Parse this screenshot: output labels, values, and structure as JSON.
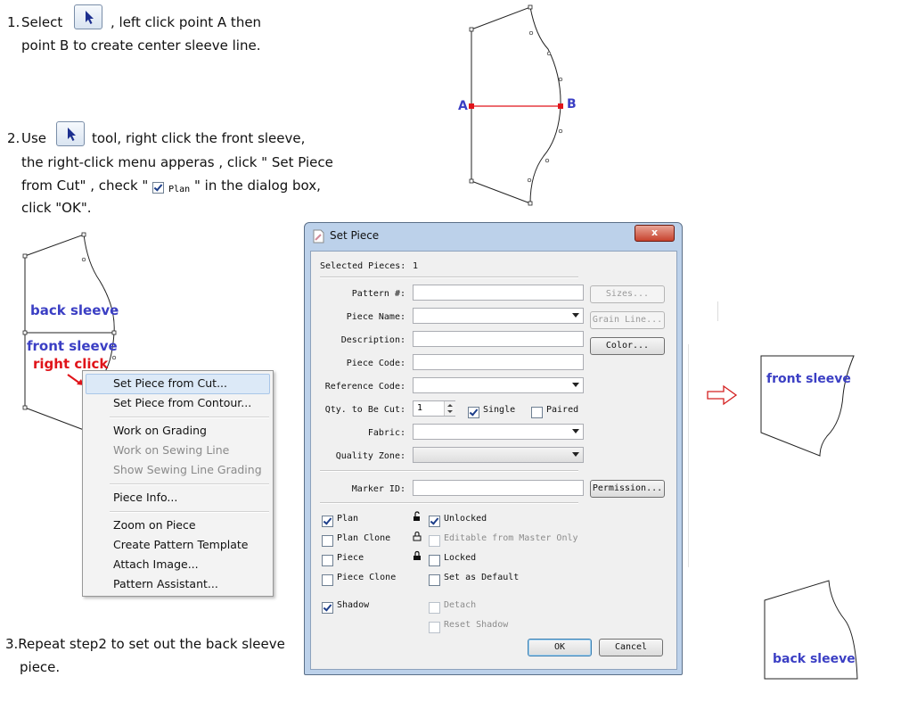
{
  "steps": {
    "s1_num": "1.",
    "s1_a": "Select",
    "s1_b": ", left click point A then",
    "s1_c": "point B to create center sleeve line.",
    "s2_num": "2.",
    "s2_a": "Use",
    "s2_b": "tool, right click the front sleeve,",
    "s2_c": "the right-click menu apperas , click \" Set Piece",
    "s2_d": "from Cut\" , check \"",
    "s2_plan": "Plan",
    "s2_e": "\"    in the dialog box,",
    "s2_f": "click \"OK\".",
    "s3_a": "3.Repeat step2 to set out the back sleeve",
    "s3_b": "piece."
  },
  "diagram": {
    "point_a": "A",
    "point_b": "B"
  },
  "labels": {
    "back_sleeve": "back sleeve",
    "front_sleeve": "front sleeve",
    "right_click": "right click",
    "front_sleeve_piece": "front sleeve",
    "back_sleeve_piece": "back sleeve"
  },
  "context_menu": {
    "items": [
      {
        "label": "Set Piece from Cut...",
        "state": "highlighted"
      },
      {
        "label": "Set Piece from Contour...",
        "state": "normal"
      },
      {
        "label": "Work on Grading",
        "state": "normal"
      },
      {
        "label": "Work on Sewing Line",
        "state": "disabled"
      },
      {
        "label": "Show Sewing Line Grading",
        "state": "disabled"
      },
      {
        "label": "Piece Info...",
        "state": "normal"
      },
      {
        "label": "Zoom on Piece",
        "state": "normal"
      },
      {
        "label": "Create Pattern Template",
        "state": "normal"
      },
      {
        "label": "Attach Image...",
        "state": "normal"
      },
      {
        "label": "Pattern Assistant...",
        "state": "normal"
      }
    ]
  },
  "dialog": {
    "title": "Set Piece",
    "close_glyph": "x",
    "selected_pieces_label": "Selected Pieces:",
    "selected_pieces_value": "1",
    "pattern_no_label": "Pattern #:",
    "piece_name_label": "Piece Name:",
    "description_label": "Description:",
    "piece_code_label": "Piece Code:",
    "reference_code_label": "Reference Code:",
    "qty_label": "Qty. to Be Cut:",
    "qty_value": "1",
    "single_label": "Single",
    "paired_label": "Paired",
    "fabric_label": "Fabric:",
    "quality_zone_label": "Quality Zone:",
    "marker_id_label": "Marker ID:",
    "sizes_button": "Sizes...",
    "grain_line_button": "Grain Line...",
    "color_button": "Color...",
    "permission_button": "Permission...",
    "plan_label": "Plan",
    "plan_clone_label": "Plan Clone",
    "piece_label": "Piece",
    "piece_clone_label": "Piece Clone",
    "shadow_label": "Shadow",
    "unlocked_label": "Unlocked",
    "editable_master_label": "Editable from Master Only",
    "locked_label": "Locked",
    "set_default_label": "Set as Default",
    "detach_label": "Detach",
    "reset_shadow_label": "Reset Shadow",
    "ok_button": "OK",
    "cancel_button": "Cancel",
    "checks": {
      "single": true,
      "paired": false,
      "plan": true,
      "plan_clone": false,
      "piece": false,
      "piece_clone": false,
      "shadow": true,
      "unlocked": true,
      "editable_master": false,
      "locked": false,
      "set_default": false,
      "detach": false,
      "reset_shadow": false
    }
  },
  "colors": {
    "accent_blue": "#3b3fc4",
    "highlight_red": "#e0141a",
    "arrow_red": "#d42020"
  },
  "icons": [
    "arrow-cursor-icon",
    "checkbox-icon",
    "window-close-icon",
    "lock-open-icon",
    "lock-icon",
    "red-arrow-icon"
  ]
}
